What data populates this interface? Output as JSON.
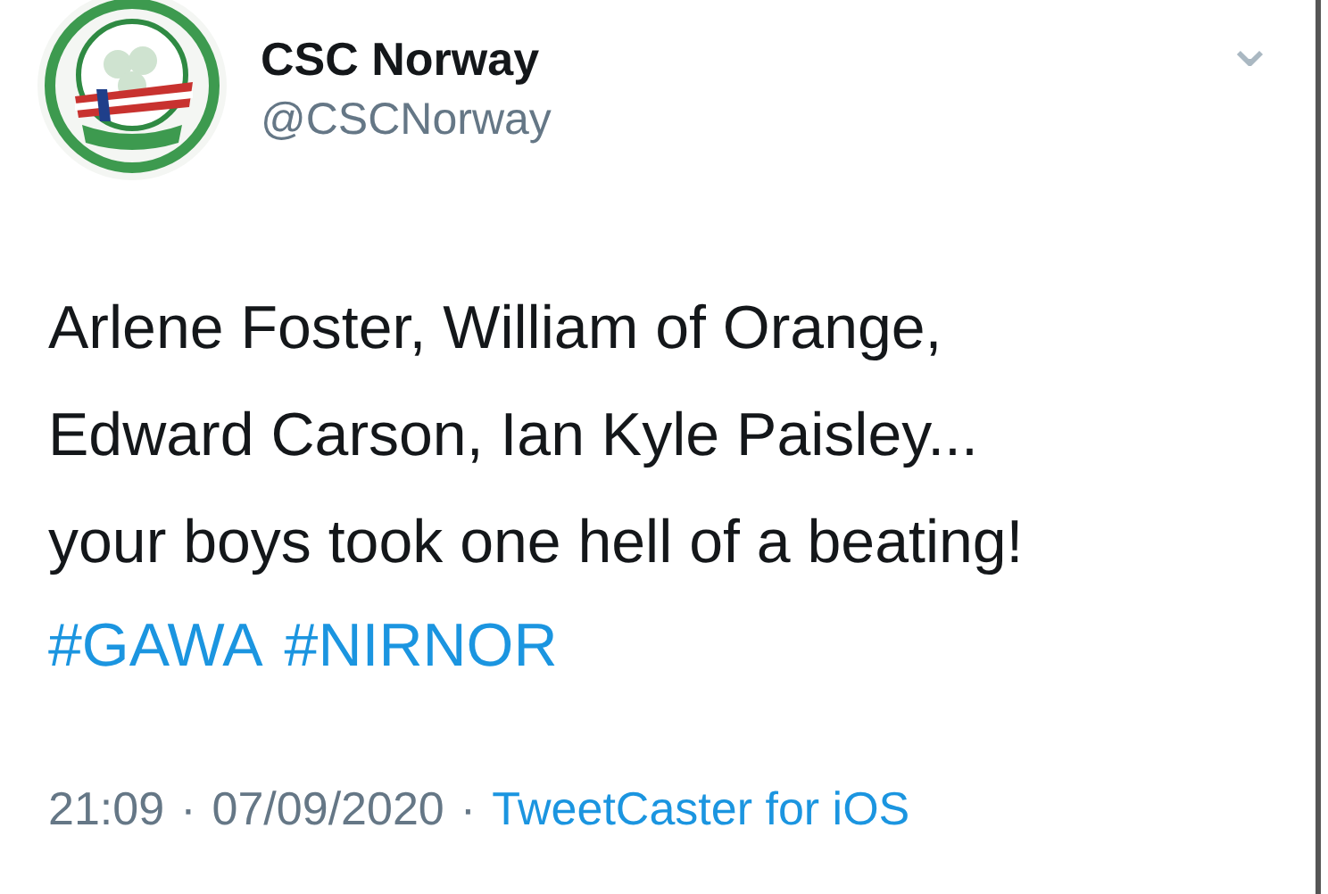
{
  "author": {
    "name": "CSC Norway",
    "handle": "@CSCNorway",
    "menu_icon": "⌄"
  },
  "tweet": {
    "text": "Arlene Foster, William of Orange,\nEdward Carson, Ian Kyle Paisley...\nyour boys took one hell of a beating!",
    "hashtags": [
      "#GAWA",
      "#NIRNOR"
    ]
  },
  "footer": {
    "time": "21:09",
    "separator_1": "·",
    "date": "07/09/2020",
    "separator_2": "·",
    "source": "TweetCaster for iOS"
  }
}
